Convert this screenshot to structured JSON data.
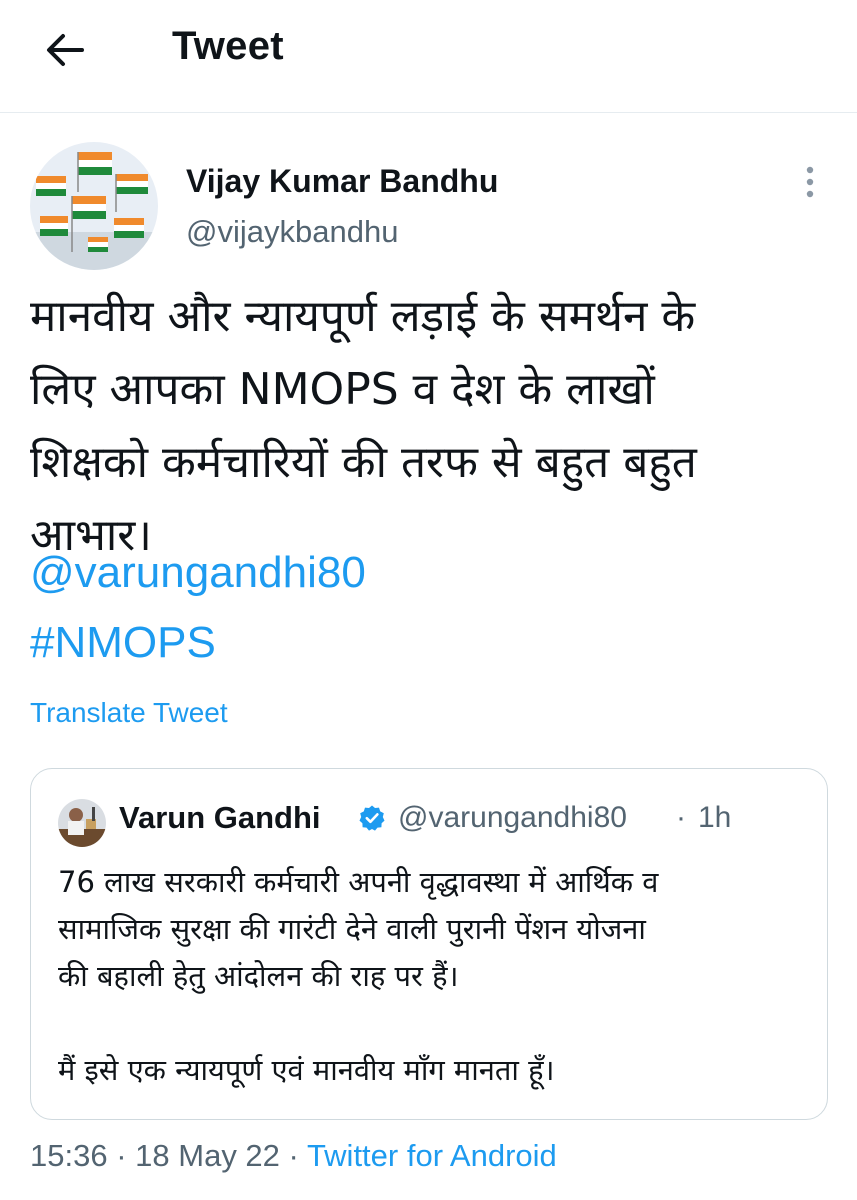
{
  "header": {
    "title": "Tweet"
  },
  "author": {
    "name": "Vijay Kumar Bandhu",
    "handle": "@vijaykbandhu"
  },
  "tweet": {
    "text": "मानवीय और न्यायपूर्ण लड़ाई के समर्थन के\nलिए आपका NMOPS व देश के लाखों\nशिक्षको कर्मचारियों की तरफ से बहुत बहुत\nआभार।",
    "mention": "@varungandhi80",
    "hashtag": "#NMOPS",
    "translate_label": "Translate Tweet"
  },
  "quote": {
    "name": "Varun Gandhi",
    "handle": "@varungandhi80",
    "separator": "·",
    "time": "1h",
    "text": "76 लाख सरकारी कर्मचारी अपनी वृद्धावस्था में आर्थिक व\nसामाजिक सुरक्षा की गारंटी देने वाली पुरानी पेंशन योजना\nकी बहाली हेतु आंदोलन की राह पर हैं।\n\nमैं इसे एक न्यायपूर्ण एवं मानवीय माँग मानता हूँ।"
  },
  "meta": {
    "time": "15:36",
    "separator": "·",
    "date": "18 May 22",
    "source": "Twitter for Android"
  },
  "icons": {
    "back": "arrow-left-icon",
    "more": "more-vertical-icon",
    "verified": "verified-badge-icon"
  },
  "colors": {
    "accent": "#1d9bf0",
    "secondary_text": "#536471",
    "primary_text": "#0f1419",
    "border": "#cfd9de"
  }
}
